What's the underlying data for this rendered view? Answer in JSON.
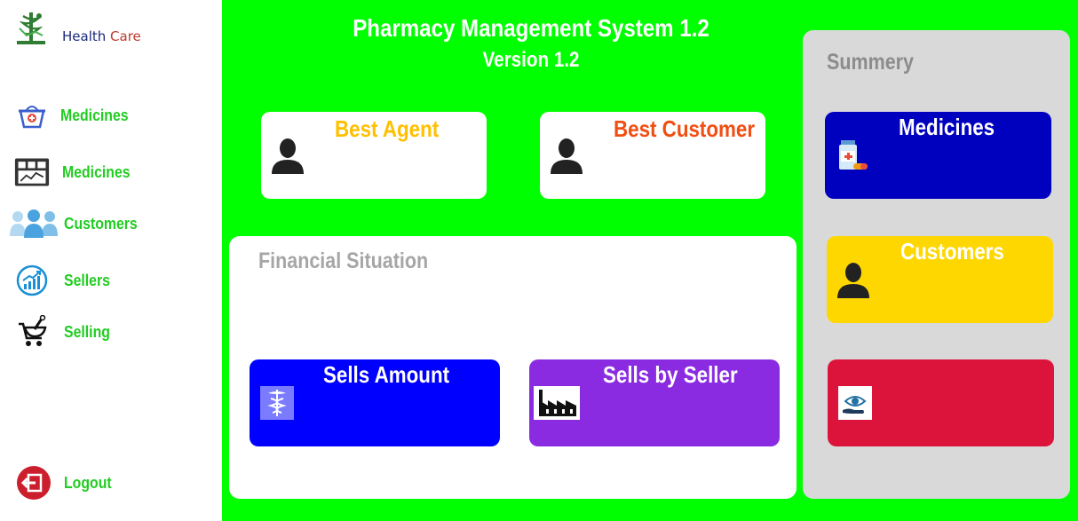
{
  "brand": {
    "name_part1": "Health",
    "name_part2": "Care",
    "logo_icon": "caduceus-pharmacy-icon"
  },
  "sidebar": {
    "items": [
      {
        "label": "Medicines",
        "icon": "medicine-basket-icon"
      },
      {
        "label": "Medicines",
        "icon": "calculator-chart-icon"
      },
      {
        "label": "Customers",
        "icon": "group-users-icon"
      },
      {
        "label": "Sellers",
        "icon": "growth-chart-icon"
      },
      {
        "label": "Selling",
        "icon": "mortar-cart-icon"
      }
    ],
    "logout_label": "Logout",
    "logout_icon": "logout-icon"
  },
  "header": {
    "title": "Pharmacy Management System 1.2",
    "version": "Version 1.2"
  },
  "top_cards": [
    {
      "title": "Best Agent",
      "title_color": "#ffc000",
      "icon": "person-icon"
    },
    {
      "title": "Best Customer",
      "title_color": "#f04e12",
      "icon": "person-icon"
    }
  ],
  "financial": {
    "title": "Financial Situation",
    "cards": [
      {
        "title": "Sells Amount",
        "bg_color": "#0000ff",
        "icon": "caduceus-icon"
      },
      {
        "title": "Sells by Seller",
        "bg_color": "#8a2be2",
        "icon": "factory-icon"
      }
    ]
  },
  "summary": {
    "title": "Summery",
    "cards": [
      {
        "title": "Medicines",
        "bg_color": "#0000bf",
        "icon": "medicine-bottle-icon"
      },
      {
        "title": "Customers",
        "bg_color": "#ffd700",
        "icon": "person-icon"
      },
      {
        "title": "",
        "bg_color": "#dc143c",
        "icon": "hand-eye-icon"
      }
    ]
  },
  "colors": {
    "main_bg": "#00ff00",
    "nav_text": "#22cc22",
    "panel_gray": "#d9d9d9"
  }
}
